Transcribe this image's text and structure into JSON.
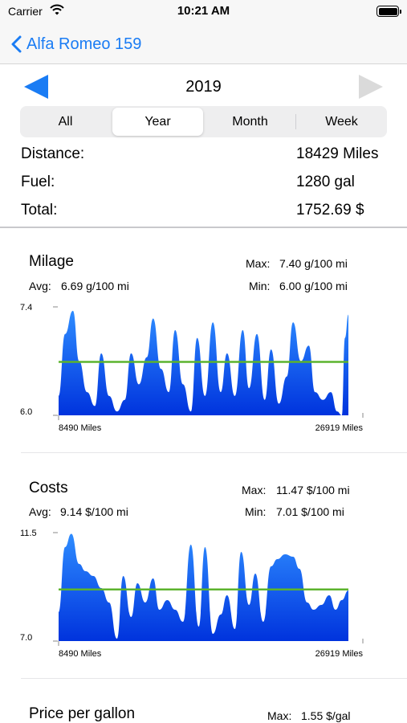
{
  "status_bar": {
    "carrier": "Carrier",
    "time": "10:21 AM"
  },
  "nav": {
    "back_label": "Alfa Romeo 159"
  },
  "period": {
    "year": "2019",
    "segments": [
      "All",
      "Year",
      "Month",
      "Week"
    ],
    "selected": "Year"
  },
  "summary": [
    {
      "label": "Distance:",
      "value": "18429 Miles"
    },
    {
      "label": "Fuel:",
      "value": "1280 gal"
    },
    {
      "label": "Total:",
      "value": "1752.69 $"
    }
  ],
  "cards": [
    {
      "title": "Milage",
      "max_label": "Max:",
      "max_value": "7.40 g/100 mi",
      "avg_label": "Avg:",
      "avg_value": "6.69 g/100 mi",
      "min_label": "Min:",
      "min_value": "6.00 g/100 mi"
    },
    {
      "title": "Costs",
      "max_label": "Max:",
      "max_value": "11.47 $/100 mi",
      "avg_label": "Avg:",
      "avg_value": "9.14 $/100 mi",
      "min_label": "Min:",
      "min_value": "7.01 $/100 mi"
    },
    {
      "title": "Price per gallon",
      "max_label": "Max:",
      "max_value": "1.55 $/gal"
    }
  ],
  "colors": {
    "accent": "#1a7cf4",
    "area_top": "#2e8cff",
    "area_bottom": "#0033dd",
    "average_line": "#5cb32e"
  },
  "chart_data": [
    {
      "type": "area",
      "y_tick_labels": [
        "7.4",
        "6.0"
      ],
      "ylim": [
        6.0,
        7.4
      ],
      "average": 6.69,
      "x_tick_labels": [
        "8490 Miles",
        "26919 Miles"
      ],
      "xlim": [
        8490,
        26919
      ],
      "x": [
        8490,
        8900,
        9400,
        9800,
        10300,
        10800,
        11200,
        11700,
        12200,
        12700,
        13100,
        13600,
        14100,
        14500,
        15000,
        15500,
        15900,
        16400,
        16900,
        17300,
        17800,
        18300,
        18800,
        19200,
        19700,
        20200,
        20600,
        21100,
        21600,
        22000,
        22500,
        23000,
        23400,
        23900,
        24400,
        24800,
        25300,
        25800,
        26200,
        26500,
        26700,
        26919
      ],
      "y": [
        6.25,
        7.05,
        7.35,
        6.7,
        6.3,
        6.12,
        6.8,
        6.25,
        6.05,
        6.2,
        6.8,
        6.4,
        6.75,
        7.25,
        6.6,
        6.3,
        7.1,
        6.4,
        6.05,
        7.0,
        6.25,
        7.2,
        6.3,
        6.8,
        6.25,
        7.1,
        6.35,
        7.05,
        6.2,
        6.85,
        6.15,
        6.5,
        7.2,
        6.7,
        6.9,
        6.3,
        6.2,
        6.3,
        6.05,
        6.0,
        7.0,
        7.3
      ]
    },
    {
      "type": "area",
      "y_tick_labels": [
        "11.5",
        "7.0"
      ],
      "ylim": [
        7.0,
        11.5
      ],
      "average": 9.14,
      "x_tick_labels": [
        "8490 Miles",
        "26919 Miles"
      ],
      "xlim": [
        8490,
        26919
      ],
      "x": [
        8490,
        8900,
        9300,
        9800,
        10200,
        10700,
        11200,
        11700,
        12200,
        12600,
        13100,
        13500,
        14000,
        14500,
        14900,
        15400,
        15900,
        16400,
        16900,
        17400,
        17800,
        18300,
        18800,
        19200,
        19700,
        20100,
        20600,
        21000,
        21500,
        22000,
        22400,
        22900,
        23400,
        23800,
        24300,
        24700,
        25200,
        25700,
        26100,
        26500,
        26919
      ],
      "y": [
        8.2,
        10.9,
        11.45,
        10.2,
        9.9,
        9.7,
        9.2,
        8.6,
        7.1,
        9.7,
        8.0,
        9.4,
        8.6,
        9.6,
        8.3,
        8.7,
        8.3,
        7.8,
        11.0,
        7.6,
        10.9,
        7.3,
        8.1,
        8.9,
        7.5,
        10.7,
        8.5,
        9.8,
        7.8,
        10.1,
        10.4,
        10.6,
        10.5,
        10.0,
        8.6,
        8.3,
        8.5,
        8.9,
        8.3,
        8.7,
        9.1
      ]
    }
  ]
}
